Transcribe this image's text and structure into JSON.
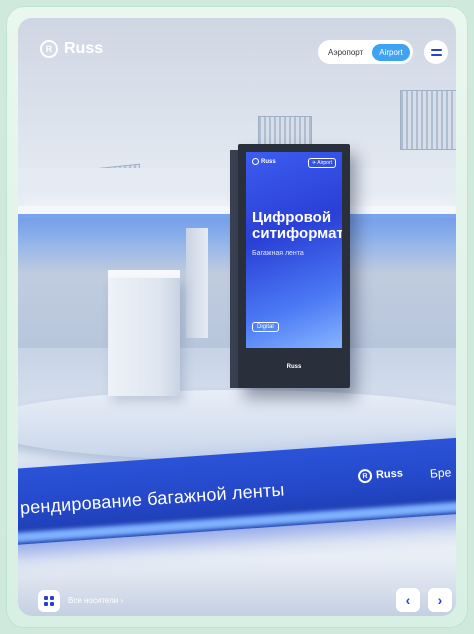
{
  "brand": {
    "name": "Russ"
  },
  "header": {
    "lang_options": [
      "Аэропорт",
      "Airport"
    ],
    "lang_active": "Airport"
  },
  "kiosk": {
    "logo": "Russ",
    "tag": "✈ Airport",
    "title": "Цифровой ситиформат",
    "subtitle": "Багажная лента",
    "badge": "Digital",
    "base_logo": "Russ"
  },
  "ribbon": {
    "text": "рендирование багажной ленты",
    "logo": "Russ",
    "more": "Бре"
  },
  "footer": {
    "all_link": "Все носители ›",
    "prev_icon": "chevron-left-icon",
    "next_icon": "chevron-right-icon"
  },
  "colors": {
    "accent": "#2a3fd6",
    "lang_active_bg": "#3ea3f2",
    "frame": "#d8efe4"
  }
}
